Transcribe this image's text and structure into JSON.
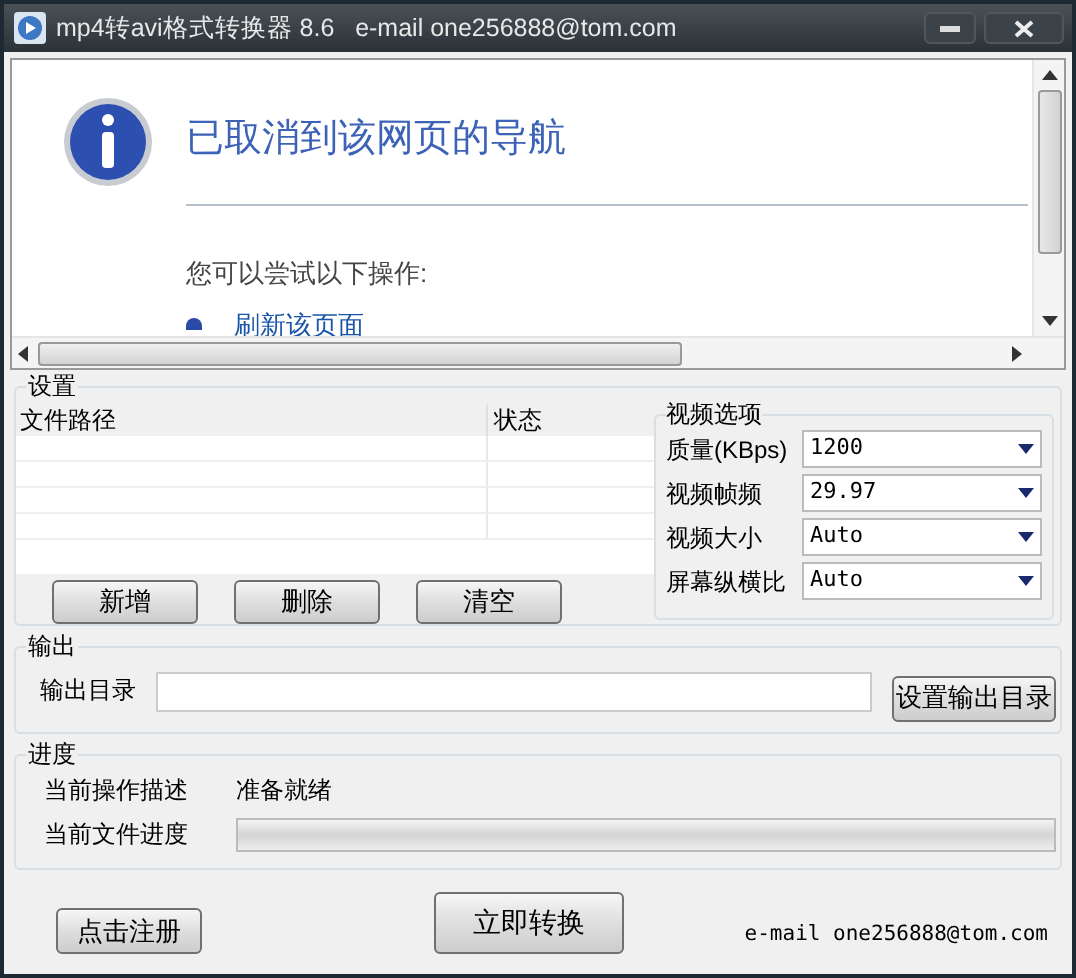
{
  "window": {
    "title": "mp4转avi格式转换器 8.6   e-mail one256888@tom.com"
  },
  "browser": {
    "heading": "已取消到该网页的导航",
    "subheading": "您可以尝试以下操作:",
    "link": "刷新该页面"
  },
  "settings": {
    "title": "设置",
    "file_table": {
      "columns": [
        "文件路径",
        "状态"
      ]
    },
    "buttons": [
      "新增",
      "删除",
      "清空"
    ],
    "video_options": {
      "title": "视频选项",
      "rows": [
        {
          "label": "质量(KBps)",
          "value": "1200"
        },
        {
          "label": "视频帧频",
          "value": "29.97"
        },
        {
          "label": "视频大小",
          "value": "Auto"
        },
        {
          "label": "屏幕纵横比",
          "value": "Auto"
        }
      ]
    }
  },
  "output": {
    "title": "输出",
    "label": "输出目录",
    "button": "设置输出目录"
  },
  "progress": {
    "title": "进度",
    "description_label": "当前操作描述",
    "description": "准备就绪",
    "file_label": "当前文件进度",
    "level": 0
  },
  "footer": {
    "register_button": "点击注册",
    "convert_button": "立即转换",
    "email": "e-mail one256888@tom.com"
  }
}
